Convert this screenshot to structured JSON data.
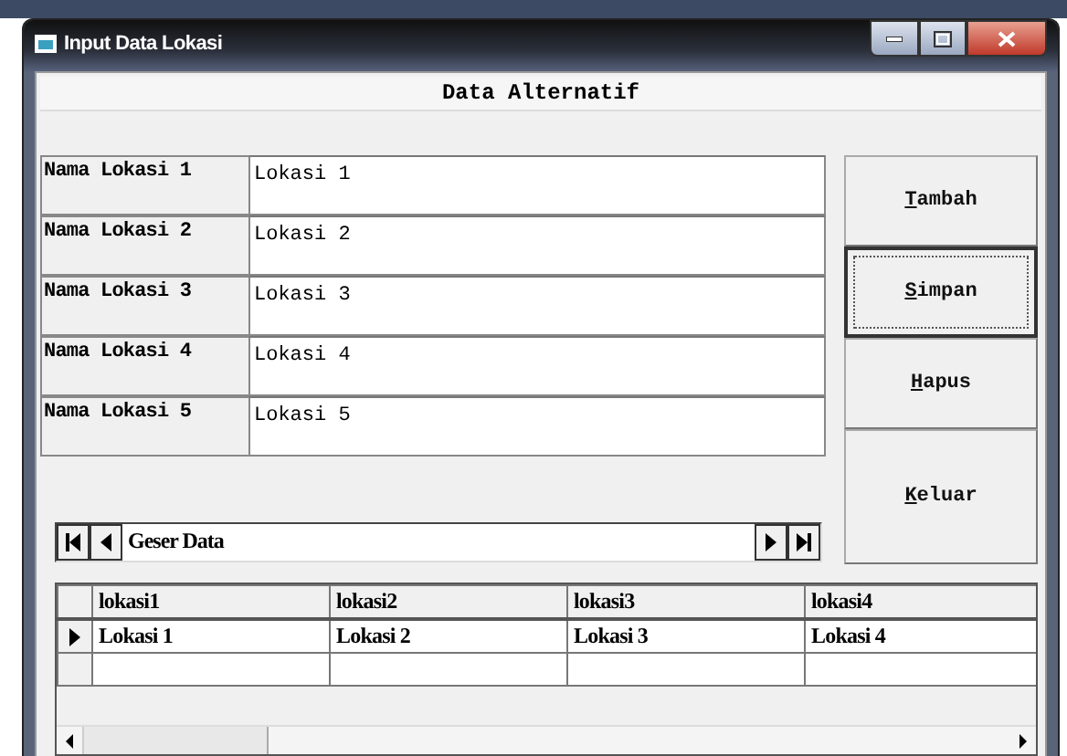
{
  "window": {
    "title": "Input Data Lokasi"
  },
  "heading": "Data Alternatif",
  "fields": [
    {
      "label": "Nama Lokasi 1",
      "value": "Lokasi 1"
    },
    {
      "label": "Nama Lokasi 2",
      "value": "Lokasi 2"
    },
    {
      "label": "Nama Lokasi 3",
      "value": "Lokasi 3"
    },
    {
      "label": "Nama Lokasi 4",
      "value": "Lokasi 4"
    },
    {
      "label": "Nama Lokasi 5",
      "value": "Lokasi 5"
    }
  ],
  "buttons": [
    {
      "label": "Tambah",
      "focused": false
    },
    {
      "label": "Simpan",
      "focused": true
    },
    {
      "label": "Hapus",
      "focused": false
    },
    {
      "label": "Keluar",
      "focused": false
    }
  ],
  "navigator": {
    "caption": "Geser Data"
  },
  "grid": {
    "columns": [
      "lokasi1",
      "lokasi2",
      "lokasi3",
      "lokasi4"
    ],
    "rows": [
      {
        "current": true,
        "cells": [
          "Lokasi 1",
          "Lokasi 2",
          "Lokasi 3",
          "Lokasi 4"
        ]
      },
      {
        "current": false,
        "cells": [
          "",
          "",
          "",
          ""
        ]
      }
    ]
  }
}
